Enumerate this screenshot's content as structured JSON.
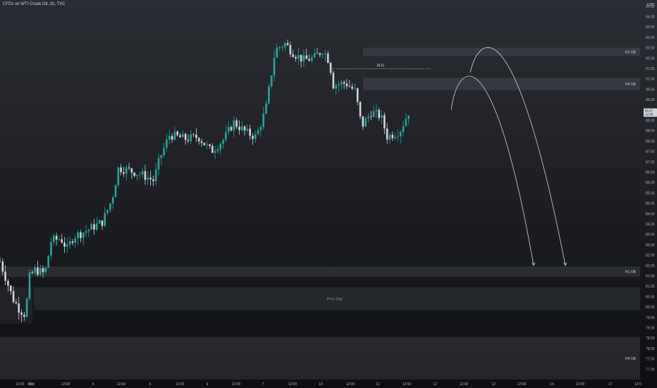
{
  "header": {
    "title": "CFDs on WTI Crude Oil, 1h, TVC"
  },
  "chart_data": {
    "type": "candlestick",
    "title": "CFDs on WTI Crude Oil, 1h, TVC",
    "y_axis_unit": "USD",
    "ylim": [
      76.5,
      94.8
    ],
    "y_ticks": [
      "94.50",
      "94.00",
      "93.50",
      "93.00",
      "92.50",
      "92.00",
      "91.50",
      "91.00",
      "90.50",
      "90.00",
      "89.50",
      "89.00",
      "88.50",
      "88.00",
      "87.50",
      "87.00",
      "86.50",
      "86.00",
      "85.50",
      "85.00",
      "84.50",
      "84.00",
      "83.50",
      "83.00",
      "82.50",
      "82.00",
      "81.50",
      "81.00",
      "80.50",
      "80.00",
      "79.50",
      "79.00",
      "78.50",
      "78.00",
      "77.50",
      "77.00"
    ],
    "x_ticks": [
      "12:00",
      "Oct",
      "12:00",
      "4",
      "12:00",
      "5",
      "12:00",
      "6",
      "12:00",
      "7",
      "12:00",
      "10",
      "12:00",
      "11",
      "12:00",
      "12",
      "12:00",
      "13",
      "12:00",
      "14",
      "12:00",
      "17",
      "12:0"
    ],
    "last_price_label": "89.57",
    "countdown_label": "12:35",
    "zones": [
      {
        "label": "H1 OB",
        "y_top": 92.5,
        "y_bottom": 92.1
      },
      {
        "label": "H4 OB",
        "y_top": 91.05,
        "y_bottom": 90.45
      },
      {
        "label": "H1 OB",
        "y_top": 81.95,
        "y_bottom": 81.45
      },
      {
        "label": "Price Gap",
        "y_top": 80.95,
        "y_bottom": 79.85
      },
      {
        "label": "H4 OB",
        "y_top": 78.55,
        "y_bottom": 76.5
      }
    ],
    "annotations": [
      {
        "label": "BOS",
        "type": "level",
        "y": 91.48
      }
    ],
    "projections": [
      {
        "name": "path-1",
        "points": [
          [
            0.713,
            90.6
          ],
          [
            0.76,
            82.0
          ]
        ]
      },
      {
        "name": "path-2",
        "points": [
          [
            0.74,
            92.3
          ],
          [
            0.81,
            82.0
          ]
        ]
      }
    ],
    "series_anchors": [
      [
        0.0,
        82.2
      ],
      [
        0.01,
        81.3
      ],
      [
        0.02,
        80.4
      ],
      [
        0.03,
        79.9
      ],
      [
        0.04,
        79.6
      ],
      [
        0.045,
        81.4
      ],
      [
        0.055,
        81.8
      ],
      [
        0.07,
        81.6
      ],
      [
        0.08,
        83.2
      ],
      [
        0.095,
        83.3
      ],
      [
        0.105,
        82.8
      ],
      [
        0.115,
        83.4
      ],
      [
        0.13,
        83.6
      ],
      [
        0.16,
        84.1
      ],
      [
        0.175,
        85.2
      ],
      [
        0.185,
        86.7
      ],
      [
        0.2,
        86.6
      ],
      [
        0.22,
        86.4
      ],
      [
        0.24,
        86.1
      ],
      [
        0.25,
        87.2
      ],
      [
        0.265,
        88.3
      ],
      [
        0.29,
        88.1
      ],
      [
        0.31,
        88.2
      ],
      [
        0.33,
        87.5
      ],
      [
        0.35,
        88.1
      ],
      [
        0.365,
        88.9
      ],
      [
        0.385,
        88.4
      ],
      [
        0.4,
        88.2
      ],
      [
        0.415,
        89.5
      ],
      [
        0.43,
        92.4
      ],
      [
        0.445,
        92.7
      ],
      [
        0.46,
        92.2
      ],
      [
        0.475,
        91.9
      ],
      [
        0.49,
        92.0
      ],
      [
        0.505,
        92.4
      ],
      [
        0.515,
        91.8
      ],
      [
        0.52,
        90.7
      ],
      [
        0.54,
        90.8
      ],
      [
        0.555,
        90.4
      ],
      [
        0.565,
        88.7
      ],
      [
        0.58,
        89.4
      ],
      [
        0.595,
        89.2
      ],
      [
        0.605,
        88.2
      ],
      [
        0.625,
        88.5
      ],
      [
        0.64,
        89.5
      ]
    ]
  }
}
